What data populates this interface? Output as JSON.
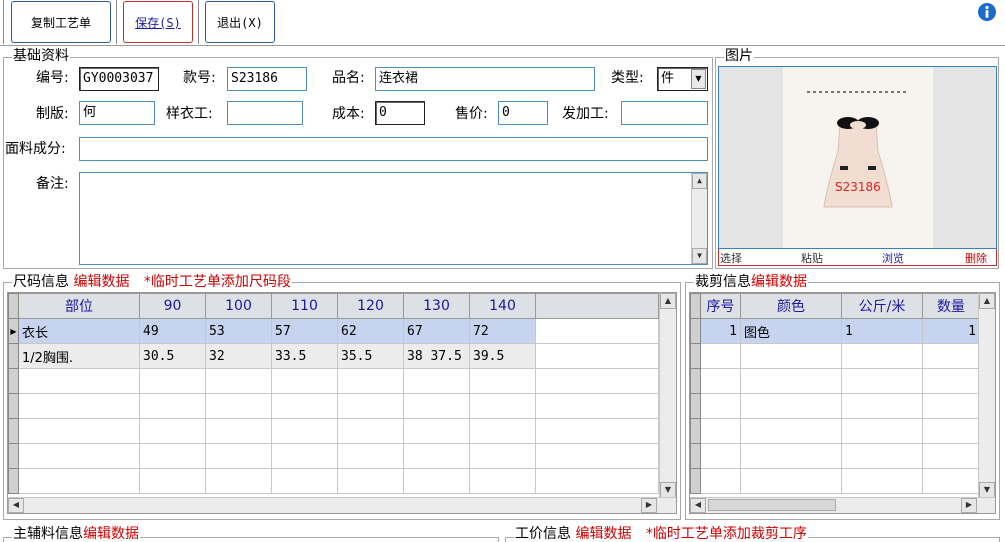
{
  "toolbar": {
    "copy_label": "复制工艺单",
    "save_label": "保存(S)",
    "exit_label": "退出(X)"
  },
  "basic": {
    "legend": "基础资料",
    "code_label": "编号:",
    "code_value": "GY0003037",
    "style_label": "款号:",
    "style_value": "S23186",
    "name_label": "品名:",
    "name_value": "连衣裙",
    "type_label": "类型:",
    "type_value": "件",
    "pattern_label": "制版:",
    "pattern_value": "何",
    "sample_label": "样衣工:",
    "sample_value": "",
    "cost_label": "成本:",
    "cost_value": "0",
    "price_label": "售价:",
    "price_value": "0",
    "worker_label": "发加工:",
    "worker_value": "",
    "fabric_label": "面料成分:",
    "fabric_value": "",
    "remark_label": "备注:",
    "remark_value": ""
  },
  "picture": {
    "legend": "图片",
    "overlay_text": "S23186",
    "select_label": "选择",
    "paste_label": "粘贴",
    "browse_label": "浏览",
    "delete_label": "删除"
  },
  "size": {
    "legend": "尺码信息",
    "edit_label": "编辑数据",
    "add_label": "*临时工艺单添加尺码段",
    "headers": [
      "部位",
      "90",
      "100",
      "110",
      "120",
      "130",
      "140"
    ],
    "rows": [
      [
        "衣长",
        "49",
        "53",
        "57",
        "62",
        "67",
        "72"
      ],
      [
        "1/2胸围.",
        "30.5",
        "32",
        "33.5",
        "35.5",
        "38 37.5",
        "39.5"
      ]
    ]
  },
  "cut": {
    "legend": "裁剪信息",
    "edit_label": "编辑数据",
    "headers": [
      "序号",
      "颜色",
      "公斤/米",
      "数量"
    ],
    "rows": [
      [
        "1",
        "图色",
        "1",
        "1"
      ]
    ]
  },
  "material": {
    "legend": "主辅料信息",
    "edit_label": "编辑数据"
  },
  "wage": {
    "legend": "工价信息",
    "edit_label": "编辑数据",
    "add_label": "*临时工艺单添加裁剪工序"
  },
  "colors": {
    "accent": "#1a1aa0",
    "highlight_row": "#c6d4f0",
    "red_text": "#cc0000",
    "info_icon": "#1b6cc9"
  }
}
